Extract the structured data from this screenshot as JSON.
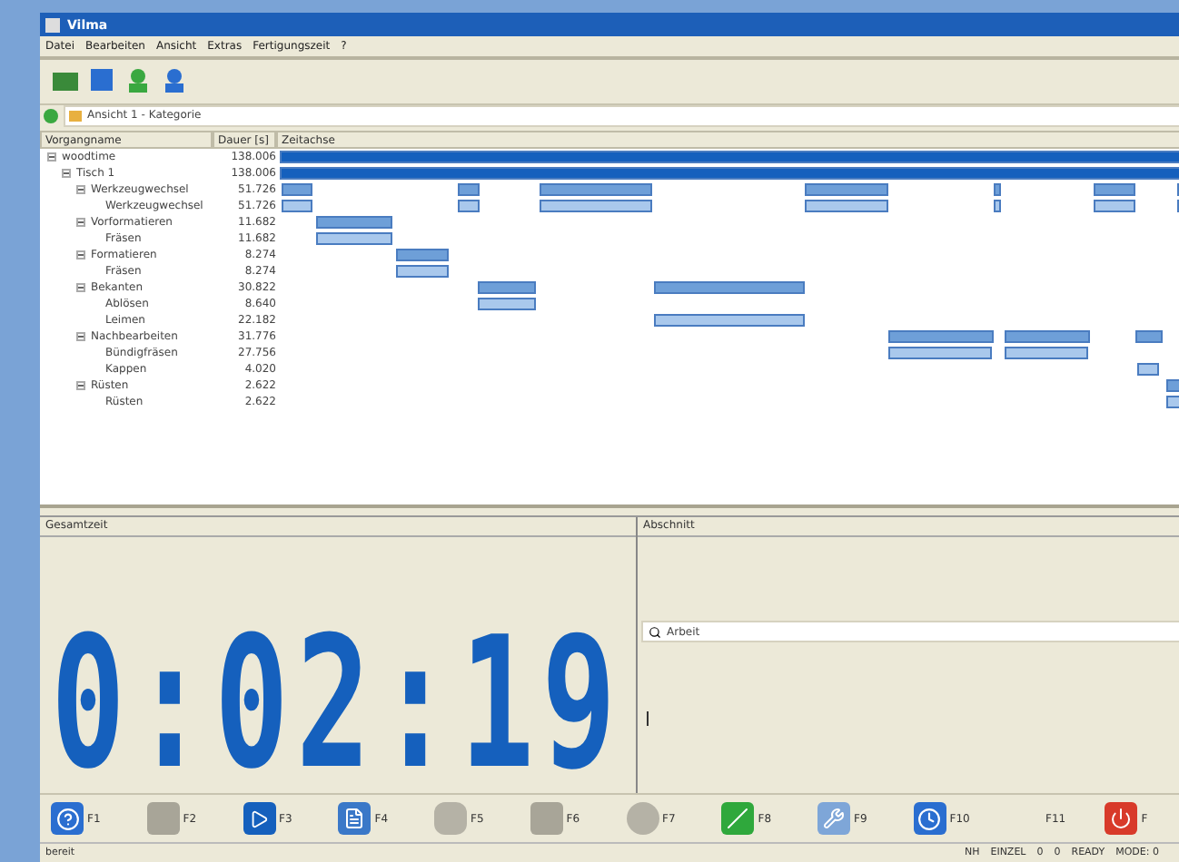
{
  "window": {
    "title": "Vilma"
  },
  "menu": [
    "Datei",
    "Bearbeiten",
    "Ansicht",
    "Extras",
    "Fertigungszeit",
    "?"
  ],
  "view_selector": {
    "value": "Ansicht 1 - Kategorie"
  },
  "table": {
    "columns": [
      "Vorgangname",
      "Dauer [s]",
      "Zeitachse"
    ],
    "rows": [
      {
        "name": "woodtime",
        "duration": "138.006",
        "expanded": true,
        "children": [
          {
            "name": "Tisch 1",
            "duration": "138.006",
            "expanded": true,
            "children": [
              {
                "name": "Werkzeugwechsel",
                "duration": "51.726",
                "expanded": true,
                "children": [
                  {
                    "name": "Werkzeugwechsel",
                    "duration": "51.726"
                  }
                ]
              },
              {
                "name": "Vorformatieren",
                "duration": "11.682",
                "expanded": true,
                "children": [
                  {
                    "name": "Fräsen",
                    "duration": "11.682"
                  }
                ]
              },
              {
                "name": "Formatieren",
                "duration": "8.274",
                "expanded": true,
                "children": [
                  {
                    "name": "Fräsen",
                    "duration": "8.274"
                  }
                ]
              },
              {
                "name": "Bekanten",
                "duration": "30.822",
                "expanded": true,
                "children": [
                  {
                    "name": "Ablösen",
                    "duration": "8.640"
                  },
                  {
                    "name": "Leimen",
                    "duration": "22.182"
                  }
                ]
              },
              {
                "name": "Nachbearbeiten",
                "duration": "31.776",
                "expanded": true,
                "children": [
                  {
                    "name": "Bündigfräsen",
                    "duration": "27.756"
                  },
                  {
                    "name": "Kappen",
                    "duration": "4.020"
                  }
                ]
              },
              {
                "name": "Rüsten",
                "duration": "2.622",
                "expanded": true,
                "children": [
                  {
                    "name": "Rüsten",
                    "duration": "2.622"
                  }
                ]
              }
            ]
          }
        ]
      }
    ]
  },
  "total_panel": {
    "title": "Gesamtzeit",
    "clock": "0:02:19"
  },
  "section_panel": {
    "title": "Abschnitt",
    "search": {
      "value": "Arbeit"
    }
  },
  "function_keys": [
    {
      "label": "F1",
      "kind": "help"
    },
    {
      "label": "F2",
      "kind": "square"
    },
    {
      "label": "F3",
      "kind": "play"
    },
    {
      "label": "F4",
      "kind": "doc"
    },
    {
      "label": "F5",
      "kind": "hex"
    },
    {
      "label": "F6",
      "kind": "square"
    },
    {
      "label": "F7",
      "kind": "circle"
    },
    {
      "label": "F8",
      "kind": "green"
    },
    {
      "label": "F9",
      "kind": "tool"
    },
    {
      "label": "F10",
      "kind": "clock"
    },
    {
      "label": "F11",
      "kind": "blank"
    },
    {
      "label": "F",
      "kind": "power"
    }
  ],
  "status_bar": [
    "bereit",
    "NH",
    "EINZEL",
    "0",
    "0",
    "READY",
    "MODE: 0"
  ]
}
